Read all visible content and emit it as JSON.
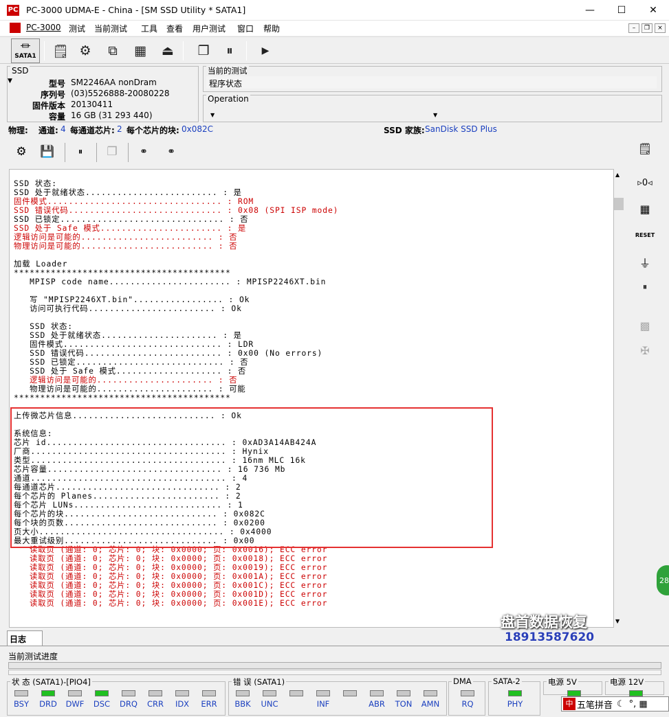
{
  "window": {
    "title": "PC-3000 UDMA-E - China - [SM SSD Utility * SATA1]",
    "app_icon": "PC",
    "minimize": "—",
    "maximize": "☐",
    "close": "✕"
  },
  "menu": {
    "items": [
      "PC-3000",
      "测试",
      "当前测试",
      "工具",
      "查看",
      "用户测试",
      "窗口",
      "帮助"
    ],
    "mdi": [
      "–",
      "❐",
      "×"
    ]
  },
  "toolbar": {
    "sata1_label": "SATA1"
  },
  "ssd": {
    "legend": "SSD",
    "rows": [
      {
        "key": "型号",
        "value": "SM2246AA nonDram"
      },
      {
        "key": "序列号",
        "value": "(03)5526888-20080228"
      },
      {
        "key": "固件版本",
        "value": "20130411"
      },
      {
        "key": "容量",
        "value": "16 GB (31 293 440)"
      }
    ]
  },
  "current_test": {
    "legend": "当前的测试",
    "value": "程序状态"
  },
  "operation": {
    "legend": "Operation"
  },
  "infobar": {
    "physical": "物理:",
    "channels_label": "通道:",
    "channels": "4",
    "chips_label": "每通道芯片:",
    "chips": "2",
    "blocks_label": "每个芯片的块:",
    "blocks": "0x082C",
    "family_label": "SSD 家族:",
    "family": "SanDisk SSD Plus"
  },
  "log": {
    "lines": [
      {
        "t": "SSD 状态:",
        "c": "k"
      },
      {
        "t": "SSD 处于就绪状态......................... : 是",
        "c": "k"
      },
      {
        "t": "固件模式................................. : ROM",
        "c": "r"
      },
      {
        "t": "SSD 错误代码............................. : 0x08 (SPI ISP mode)",
        "c": "r"
      },
      {
        "t": "SSD 已锁定............................... : 否",
        "c": "k"
      },
      {
        "t": "SSD 处于 Safe 模式....................... : 是",
        "c": "r"
      },
      {
        "t": "逻辑访问是可能的......................... : 否",
        "c": "r"
      },
      {
        "t": "物理访问是可能的......................... : 否",
        "c": "r"
      },
      {
        "t": "",
        "c": "k"
      },
      {
        "t": "加载 Loader",
        "c": "k"
      },
      {
        "t": "*****************************************",
        "c": "k"
      },
      {
        "t": "   MPISP code name....................... : MPISP2246XT.bin",
        "c": "k"
      },
      {
        "t": "",
        "c": "k"
      },
      {
        "t": "   写 \"MPISP2246XT.bin\"................. : Ok",
        "c": "k"
      },
      {
        "t": "   访问可执行代码........................ : Ok",
        "c": "k"
      },
      {
        "t": "",
        "c": "k"
      },
      {
        "t": "   SSD 状态:",
        "c": "k"
      },
      {
        "t": "   SSD 处于就绪状态...................... : 是",
        "c": "k"
      },
      {
        "t": "   固件模式.............................. : LDR",
        "c": "k"
      },
      {
        "t": "   SSD 错误代码.......................... : 0x00 (No errors)",
        "c": "k"
      },
      {
        "t": "   SSD 已锁定............................ : 否",
        "c": "k"
      },
      {
        "t": "   SSD 处于 Safe 模式.................... : 否",
        "c": "k"
      },
      {
        "t": "   逻辑访问是可能的...................... : 否",
        "c": "r"
      },
      {
        "t": "   物理访问是可能的...................... : 可能",
        "c": "k"
      },
      {
        "t": "*****************************************",
        "c": "k"
      },
      {
        "t": "",
        "c": "k"
      },
      {
        "t": "上传微芯片信息........................... : Ok",
        "c": "k"
      },
      {
        "t": "",
        "c": "k"
      },
      {
        "t": "系统信息:",
        "c": "k"
      },
      {
        "t": "芯片 id.................................. : 0xAD3A14AB424A",
        "c": "k"
      },
      {
        "t": "厂商..................................... : Hynix",
        "c": "k"
      },
      {
        "t": "类型..................................... : 16nm MLC 16k",
        "c": "k"
      },
      {
        "t": "芯片容量................................. : 16 736 Mb",
        "c": "k"
      },
      {
        "t": "通道..................................... : 4",
        "c": "k"
      },
      {
        "t": "每通道芯片............................... : 2",
        "c": "k"
      },
      {
        "t": "每个芯片的 Planes........................ : 2",
        "c": "k"
      },
      {
        "t": "每个芯片 LUNs............................ : 1",
        "c": "k"
      },
      {
        "t": "每个芯片的块............................. : 0x082C",
        "c": "k"
      },
      {
        "t": "每个块的页数............................. : 0x0200",
        "c": "k"
      },
      {
        "t": "页大小................................... : 0x4000",
        "c": "k"
      },
      {
        "t": "最大重试级别............................. : 0x00",
        "c": "k"
      },
      {
        "t": "   读取页 (通道: 0; 芯片: 0; 块: 0x0000; 页: 0x0016); ECC error",
        "c": "r"
      },
      {
        "t": "   读取页 (通道: 0; 芯片: 0; 块: 0x0000; 页: 0x0018); ECC error",
        "c": "r"
      },
      {
        "t": "   读取页 (通道: 0; 芯片: 0; 块: 0x0000; 页: 0x0019); ECC error",
        "c": "r"
      },
      {
        "t": "   读取页 (通道: 0; 芯片: 0; 块: 0x0000; 页: 0x001A); ECC error",
        "c": "r"
      },
      {
        "t": "   读取页 (通道: 0; 芯片: 0; 块: 0x0000; 页: 0x001C); ECC error",
        "c": "r"
      },
      {
        "t": "   读取页 (通道: 0; 芯片: 0; 块: 0x0000; 页: 0x001D); ECC error",
        "c": "r"
      },
      {
        "t": "   读取页 (通道: 0; 芯片: 0; 块: 0x0000; 页: 0x001E); ECC error",
        "c": "r"
      }
    ]
  },
  "tabs": {
    "log": "日志"
  },
  "progress": {
    "label": "当前测试进度"
  },
  "status": {
    "state_title": "状 态 (SATA1)-[PIO4]",
    "state": [
      {
        "l": "BSY",
        "on": false
      },
      {
        "l": "DRD",
        "on": true
      },
      {
        "l": "DWF",
        "on": false
      },
      {
        "l": "DSC",
        "on": true
      },
      {
        "l": "DRQ",
        "on": false
      },
      {
        "l": "CRR",
        "on": false
      },
      {
        "l": "IDX",
        "on": false
      },
      {
        "l": "ERR",
        "on": false
      }
    ],
    "error_title": "错 误 (SATA1)",
    "error": [
      {
        "l": "BBK",
        "on": false
      },
      {
        "l": "UNC",
        "on": false
      },
      {
        "l": "",
        "on": false
      },
      {
        "l": "INF",
        "on": false
      },
      {
        "l": "",
        "on": false
      },
      {
        "l": "ABR",
        "on": false
      },
      {
        "l": "TON",
        "on": false
      },
      {
        "l": "AMN",
        "on": false
      }
    ],
    "dma_title": "DMA",
    "dma": [
      {
        "l": "RQ",
        "on": false
      }
    ],
    "sata2_title": "SATA-2",
    "sata2": [
      {
        "l": "PHY",
        "on": true
      }
    ],
    "p5_title": "电源 5V",
    "p12_title": "电源 12V"
  },
  "watermark": {
    "brand": "盘首数据恢复",
    "phone": "18913587620"
  },
  "ime": {
    "label": "五笔拼音"
  },
  "badge": {
    "text": "28"
  },
  "colors": {
    "accent_red": "#cc0000",
    "led_on": "#20c020",
    "link_blue": "#1a3fbf"
  }
}
